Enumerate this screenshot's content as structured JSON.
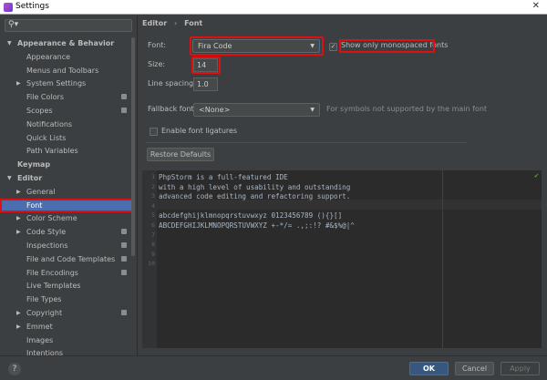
{
  "window": {
    "title": "Settings"
  },
  "sidebar": {
    "search_placeholder": "",
    "items": [
      {
        "label": "Appearance & Behavior",
        "level": 0,
        "expanded": true,
        "bold": true
      },
      {
        "label": "Appearance",
        "level": 1
      },
      {
        "label": "Menus and Toolbars",
        "level": 1
      },
      {
        "label": "System Settings",
        "level": 1,
        "collapsed": true
      },
      {
        "label": "File Colors",
        "level": 1,
        "badge": true
      },
      {
        "label": "Scopes",
        "level": 1,
        "badge": true
      },
      {
        "label": "Notifications",
        "level": 1
      },
      {
        "label": "Quick Lists",
        "level": 1
      },
      {
        "label": "Path Variables",
        "level": 1
      },
      {
        "label": "Keymap",
        "level": 0,
        "bold": true
      },
      {
        "label": "Editor",
        "level": 0,
        "expanded": true,
        "bold": true
      },
      {
        "label": "General",
        "level": 1,
        "collapsed": true
      },
      {
        "label": "Font",
        "level": 1,
        "selected": true
      },
      {
        "label": "Color Scheme",
        "level": 1,
        "collapsed": true
      },
      {
        "label": "Code Style",
        "level": 1,
        "collapsed": true,
        "badge": true
      },
      {
        "label": "Inspections",
        "level": 1,
        "badge": true
      },
      {
        "label": "File and Code Templates",
        "level": 1,
        "badge": true
      },
      {
        "label": "File Encodings",
        "level": 1,
        "badge": true
      },
      {
        "label": "Live Templates",
        "level": 1
      },
      {
        "label": "File Types",
        "level": 1
      },
      {
        "label": "Copyright",
        "level": 1,
        "collapsed": true,
        "badge": true
      },
      {
        "label": "Emmet",
        "level": 1,
        "collapsed": true
      },
      {
        "label": "Images",
        "level": 1
      },
      {
        "label": "Intentions",
        "level": 1
      }
    ]
  },
  "breadcrumb": {
    "parent": "Editor",
    "sep": "›",
    "current": "Font"
  },
  "form": {
    "font_label": "Font:",
    "font_value": "Fira Code",
    "mono_label": "Show only monospaced fonts",
    "mono_checked": true,
    "size_label": "Size:",
    "size_value": "14",
    "spacing_label": "Line spacing:",
    "spacing_value": "1.0",
    "fallback_label": "Fallback font:",
    "fallback_value": "<None>",
    "fallback_hint": "For symbols not supported by the main font",
    "ligatures_label": "Enable font ligatures",
    "ligatures_checked": false,
    "restore_label": "Restore Defaults"
  },
  "preview": {
    "lines": [
      "PhpStorm is a full-featured IDE",
      "with a high level of usability and outstanding",
      "advanced code editing and refactoring support.",
      "",
      "abcdefghijklmnopqrstuvwxyz 0123456789 (){}[]",
      "ABCDEFGHIJKLMNOPQRSTUVWXYZ +-*/= .,;:!? #&$%@|^",
      "",
      "",
      "",
      ""
    ]
  },
  "footer": {
    "help": "?",
    "ok": "OK",
    "cancel": "Cancel",
    "apply": "Apply"
  },
  "colors": {
    "accent": "#4b6eaf",
    "highlight": "#e01010",
    "ok": "#365880"
  }
}
